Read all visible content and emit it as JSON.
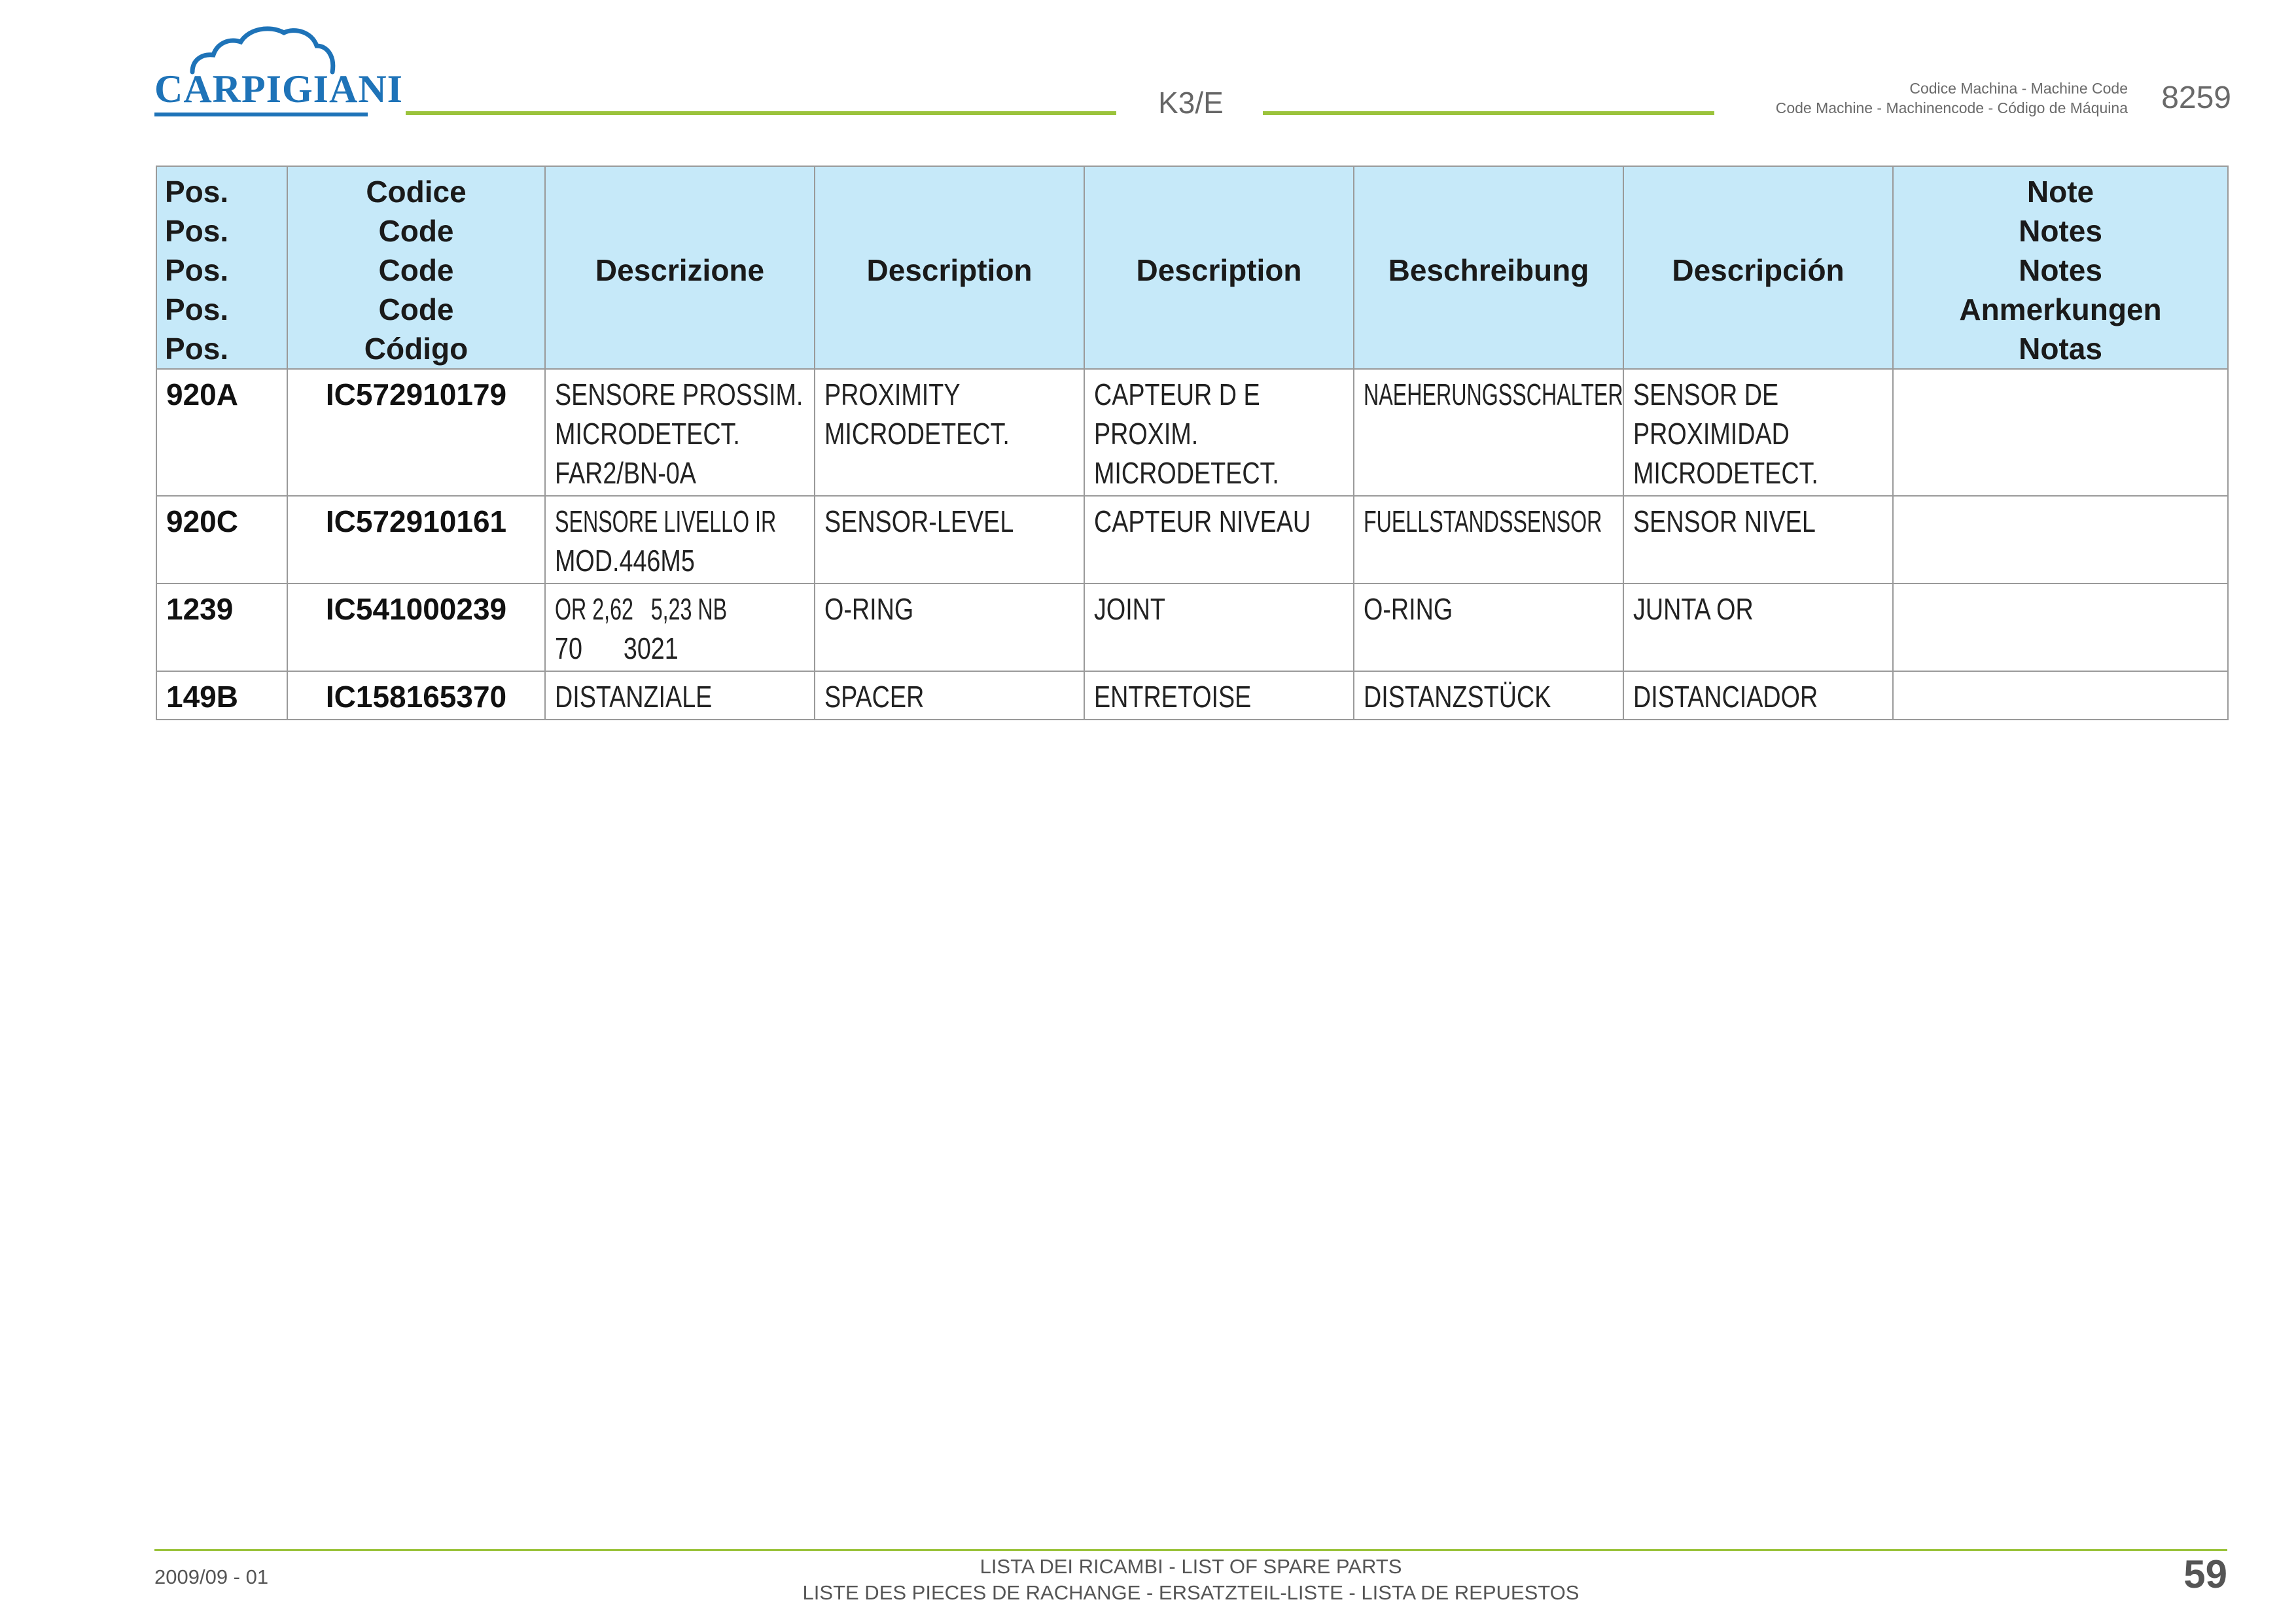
{
  "brand": {
    "name": "CARPIGIANI",
    "color": "#1e73b8"
  },
  "header": {
    "model": "K3/E",
    "machine_code_label_line1": "Codice Machina - Machine Code",
    "machine_code_label_line2": "Code Machine - Machinencode - Código de Máquina",
    "machine_code": "8259",
    "accent_color": "#9bc33c"
  },
  "table": {
    "header_color": "#c6e9f9",
    "columns": {
      "pos": [
        "Pos.",
        "Pos.",
        "Pos.",
        "Pos.",
        "Pos."
      ],
      "code": [
        "Codice",
        "Code",
        "Code",
        "Code",
        "Código"
      ],
      "it": "Descrizione",
      "en": "Description",
      "fr": "Description",
      "de": "Beschreibung",
      "es": "Descripción",
      "notes": [
        "Note",
        "Notes",
        "Notes",
        "Anmerkungen",
        "Notas"
      ]
    },
    "rows": [
      {
        "pos": "920A",
        "code": "IC572910179",
        "it": [
          "SENSORE PROSSIM.",
          "MICRODETECT.",
          "FAR2/BN-0A"
        ],
        "en": [
          "PROXIMITY",
          "MICRODETECT."
        ],
        "fr": [
          "CAPTEUR D E",
          "PROXIM.",
          "MICRODETECT."
        ],
        "de": [
          "NAEHERUNGSSCHALTER"
        ],
        "es": [
          "SENSOR DE",
          "PROXIMIDAD",
          "MICRODETECT."
        ],
        "notes": ""
      },
      {
        "pos": "920C",
        "code": "IC572910161",
        "it": [
          "SENSORE LIVELLO IR",
          "MOD.446M5"
        ],
        "en": [
          "SENSOR-LEVEL"
        ],
        "fr": [
          "CAPTEUR NIVEAU"
        ],
        "de": [
          "FUELLSTANDSSENSOR"
        ],
        "es": [
          "SENSOR NIVEL"
        ],
        "notes": ""
      },
      {
        "pos": "1239",
        "code": "IC541000239",
        "it": [
          "OR 2,62   5,23 NB",
          "70      3021"
        ],
        "en": [
          "O-RING"
        ],
        "fr": [
          "JOINT"
        ],
        "de": [
          "O-RING"
        ],
        "es": [
          "JUNTA OR"
        ],
        "notes": ""
      },
      {
        "pos": "149B",
        "code": "IC158165370",
        "it": [
          "DISTANZIALE"
        ],
        "en": [
          "SPACER"
        ],
        "fr": [
          "ENTRETOISE"
        ],
        "de": [
          "DISTANZSTÜCK"
        ],
        "es": [
          "DISTANCIADOR"
        ],
        "notes": ""
      }
    ]
  },
  "footer": {
    "date": "2009/09 - 01",
    "title_line1": "LISTA DEI RICAMBI - LIST OF SPARE PARTS",
    "title_line2": "LISTE DES PIECES DE RACHANGE - ERSATZTEIL-LISTE - LISTA DE REPUESTOS",
    "page": "59"
  }
}
